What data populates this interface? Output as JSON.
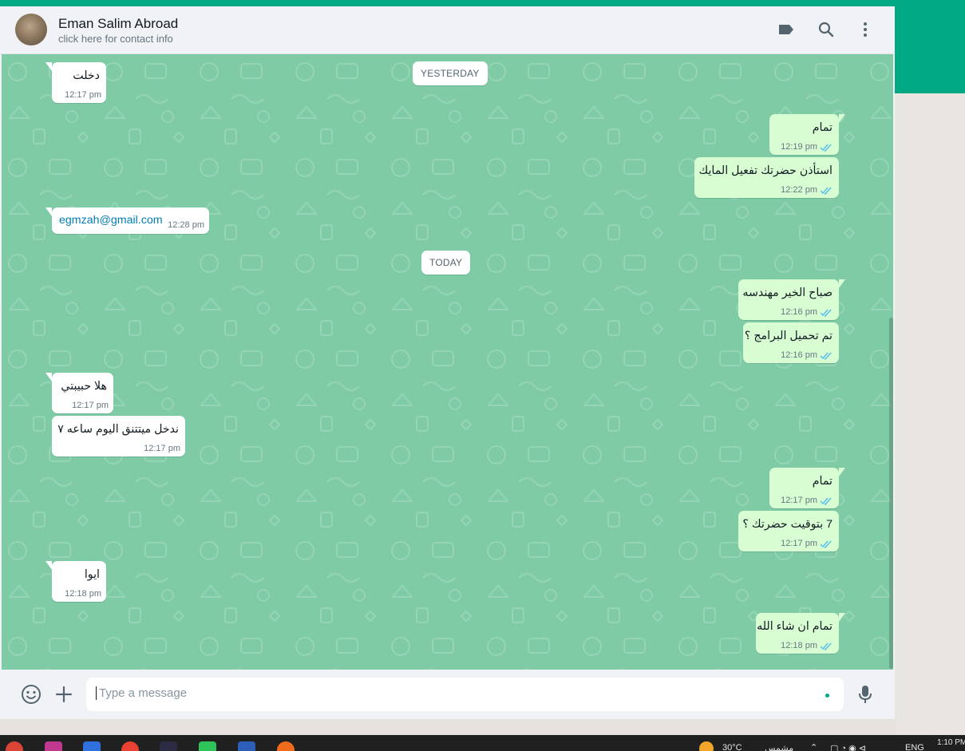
{
  "header": {
    "contact_name": "Eman Salim Abroad",
    "contact_subtitle": "click here for contact info",
    "icons": [
      "label-icon",
      "search-icon",
      "menu-icon"
    ]
  },
  "chat": {
    "date_labels": {
      "yesterday": "YESTERDAY",
      "today": "TODAY"
    },
    "messages": [
      {
        "dir": "in",
        "text": "دخلت",
        "time": "12:17 pm"
      },
      {
        "dir": "out",
        "text": "تمام",
        "time": "12:19 pm"
      },
      {
        "dir": "out",
        "text": "استأذن حضرتك تفعيل المايك",
        "time": "12:22 pm"
      },
      {
        "dir": "in",
        "text": "egmzah@gmail.com",
        "time": "12:28 pm"
      },
      {
        "dir": "out",
        "text": "صباح الخير مهندسه",
        "time": "12:16 pm"
      },
      {
        "dir": "out",
        "text": "تم تحميل البرامج ؟",
        "time": "12:16 pm"
      },
      {
        "dir": "in",
        "text": "هلا حبيبتي",
        "time": "12:17 pm"
      },
      {
        "dir": "in",
        "text": "ندخل ميتتنق اليوم ساعه ٧",
        "time": "12:17 pm"
      },
      {
        "dir": "out",
        "text": "تمام",
        "time": "12:17 pm"
      },
      {
        "dir": "out",
        "text": "7 بتوقيت حضرتك ؟",
        "time": "12:17 pm"
      },
      {
        "dir": "in",
        "text": "ايوا",
        "time": "12:18 pm"
      },
      {
        "dir": "out",
        "text": "تمام ان شاء الله",
        "time": "12:18 pm"
      }
    ]
  },
  "footer": {
    "placeholder": "Type a message",
    "value": ""
  },
  "taskbar": {
    "weather": "30°C",
    "weather_text": "مشمس",
    "language": "ENG",
    "time": "1:10 PM"
  },
  "colors": {
    "accent": "#00a884",
    "chat_bg": "#7ecba6",
    "outgoing_bubble": "#d9fdd3",
    "incoming_bubble": "#ffffff",
    "read_tick": "#53bdeb"
  }
}
